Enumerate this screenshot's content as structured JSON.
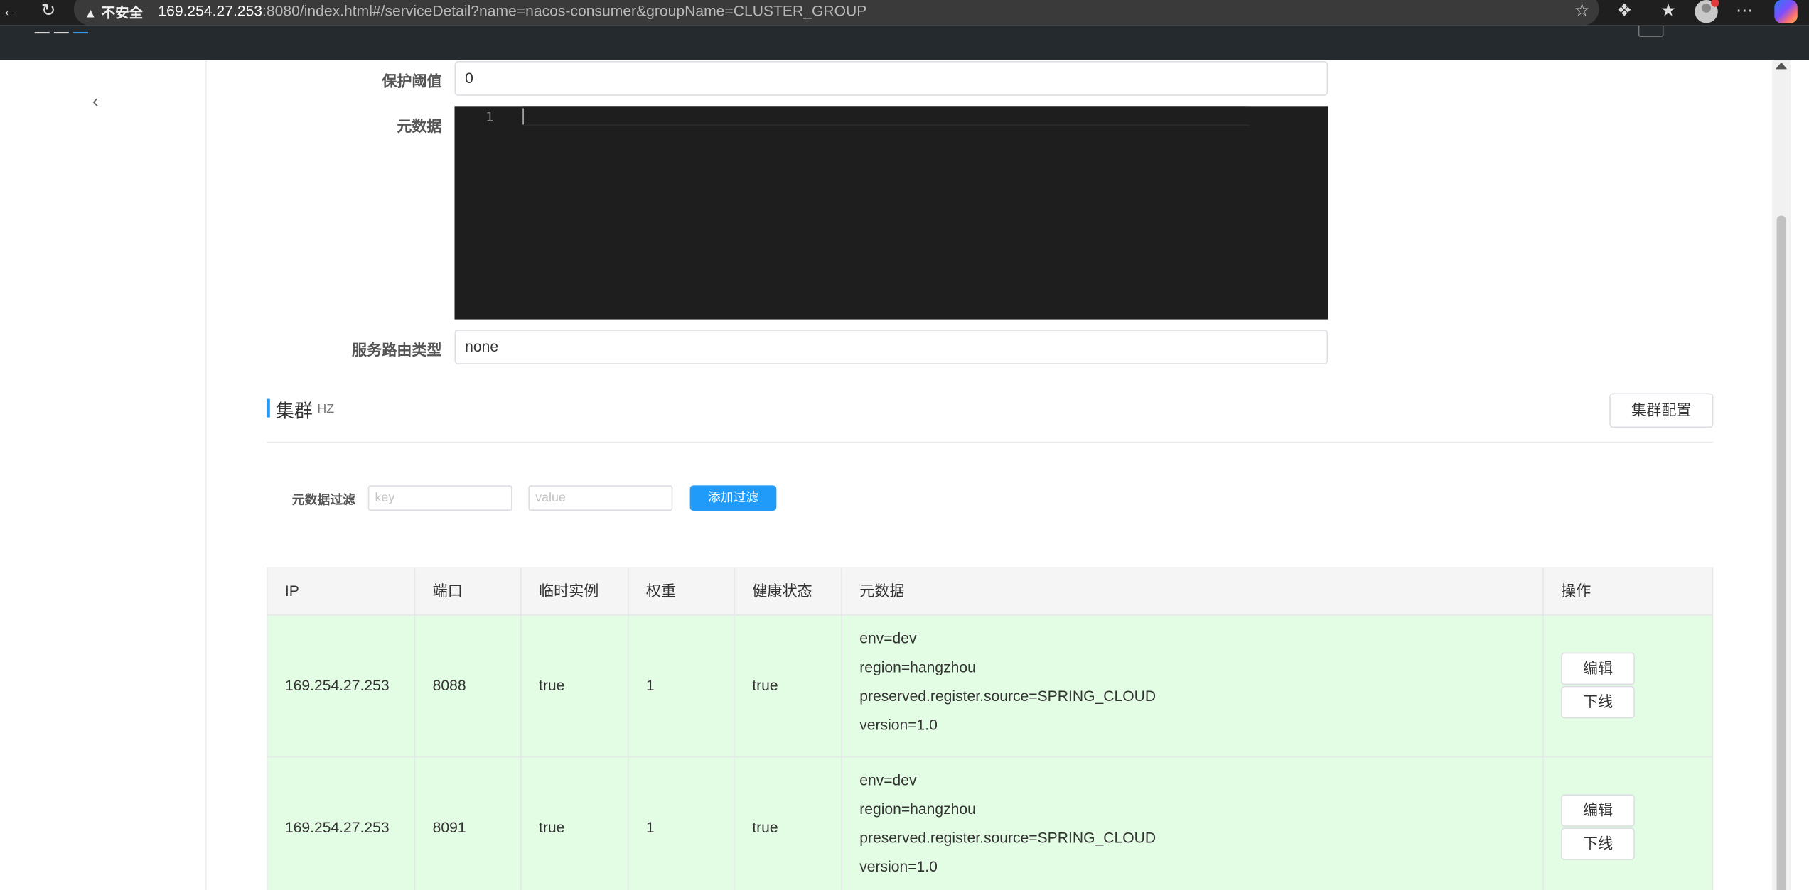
{
  "browser": {
    "insecure_label": "不安全",
    "url_host": "169.254.27.253",
    "url_rest": ":8080/index.html#/serviceDetail?name=nacos-consumer&groupName=CLUSTER_GROUP"
  },
  "form": {
    "protect_threshold_label": "保护阈值",
    "protect_threshold_value": "0",
    "metadata_label": "元数据",
    "editor_line_number": "1",
    "route_type_label": "服务路由类型",
    "route_type_value": "none"
  },
  "cluster": {
    "title": "集群",
    "name": "HZ",
    "config_button": "集群配置",
    "filter_label": "元数据过滤",
    "filter_key_placeholder": "key",
    "filter_value_placeholder": "value",
    "add_filter_button": "添加过滤"
  },
  "table": {
    "headers": [
      "IP",
      "端口",
      "临时实例",
      "权重",
      "健康状态",
      "元数据",
      "操作"
    ],
    "rows": [
      {
        "ip": "169.254.27.253",
        "port": "8088",
        "ephemeral": "true",
        "weight": "1",
        "healthy": "true",
        "metadata": [
          "env=dev",
          "region=hangzhou",
          "preserved.register.source=SPRING_CLOUD",
          "version=1.0"
        ],
        "edit_label": "编辑",
        "offline_label": "下线"
      },
      {
        "ip": "169.254.27.253",
        "port": "8091",
        "ephemeral": "true",
        "weight": "1",
        "healthy": "true",
        "metadata": [
          "env=dev",
          "region=hangzhou",
          "preserved.register.source=SPRING_CLOUD",
          "version=1.0"
        ],
        "edit_label": "编辑",
        "offline_label": "下线"
      }
    ]
  },
  "colors": {
    "primary": "#209bfa",
    "row_healthy_bg": "#e3fde4",
    "editor_bg": "#1e1e1e"
  },
  "icons": [
    "back-arrow-icon",
    "refresh-icon",
    "warning-icon",
    "favorite-star-icon",
    "extensions-icon",
    "favorites-icon",
    "profile-icon",
    "more-icon",
    "copilot-icon",
    "collapse-sidebar-icon",
    "scroll-up-icon"
  ]
}
